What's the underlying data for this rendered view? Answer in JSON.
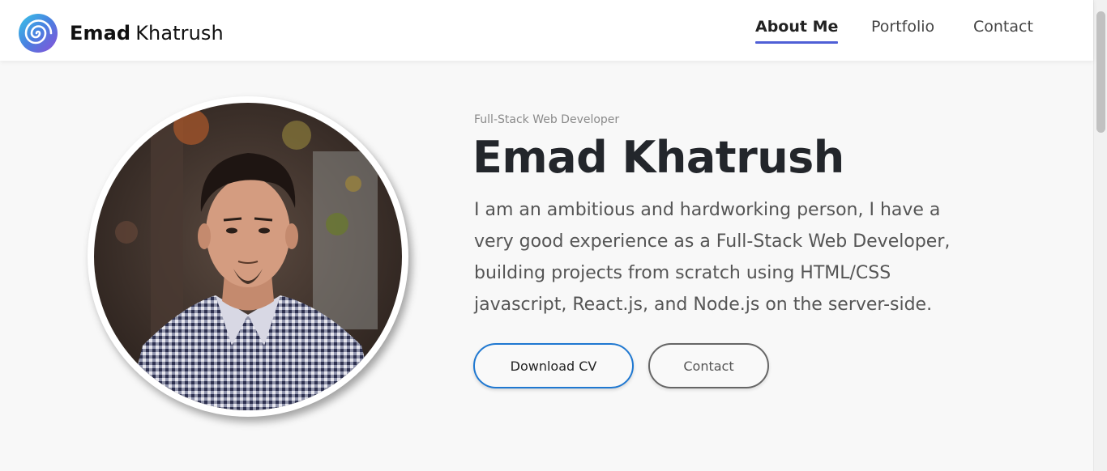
{
  "header": {
    "brand_first": "Emad",
    "brand_last": "Khatrush",
    "logo_icon": "spiral-logo-icon",
    "nav": [
      {
        "label": "About Me",
        "active": true
      },
      {
        "label": "Portfolio",
        "active": false
      },
      {
        "label": "Contact",
        "active": false
      }
    ]
  },
  "hero": {
    "subtitle": "Full-Stack Web Developer",
    "name": "Emad Khatrush",
    "bio": "I am an ambitious and hardworking person, I have a very good experience as a Full-Stack Web Developer, building projects from scratch using HTML/CSS javascript, React.js, and Node.js on the server-side.",
    "buttons": {
      "download_cv": "Download CV",
      "contact": "Contact"
    }
  },
  "colors": {
    "accent": "#4f5fd6",
    "button_primary_border": "#1f78d1",
    "title": "#23262b",
    "page_background": "#f8f8f8"
  }
}
